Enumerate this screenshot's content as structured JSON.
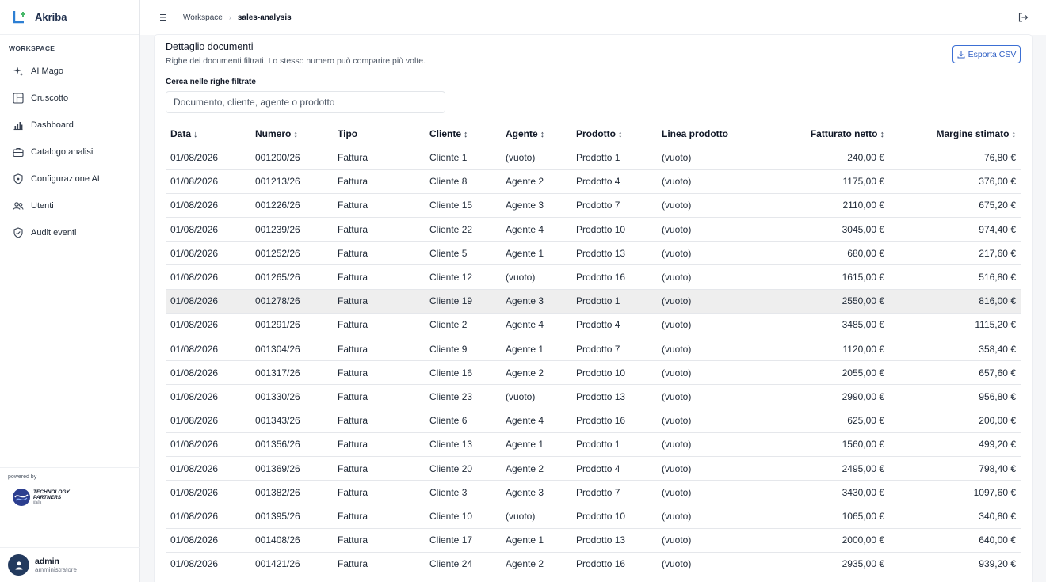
{
  "app": {
    "name": "Akriba"
  },
  "sidebar": {
    "section": "WORKSPACE",
    "items": [
      {
        "label": "AI Mago",
        "icon": "sparkle-icon"
      },
      {
        "label": "Cruscotto",
        "icon": "layout-icon"
      },
      {
        "label": "Dashboard",
        "icon": "bar-chart-icon"
      },
      {
        "label": "Catalogo analisi",
        "icon": "briefcase-icon"
      },
      {
        "label": "Configurazione AI",
        "icon": "shield-icon"
      },
      {
        "label": "Utenti",
        "icon": "users-icon"
      },
      {
        "label": "Audit eventi",
        "icon": "shield-check-icon"
      }
    ],
    "powered_by": "powered by",
    "partner_line1": "TECHNOLOGY",
    "partner_line2": "PARTNERS",
    "partner_line3": "italia"
  },
  "user": {
    "name": "admin",
    "role": "amministratore"
  },
  "breadcrumb": {
    "root": "Workspace",
    "current": "sales-analysis"
  },
  "card": {
    "title": "Dettaglio documenti",
    "subtitle": "Righe dei documenti filtrati. Lo stesso numero può comparire più volte.",
    "export_label": "Esporta CSV",
    "search_label": "Cerca nelle righe filtrate",
    "search_placeholder": "Documento, cliente, agente o prodotto"
  },
  "table": {
    "columns": [
      {
        "label": "Data",
        "sort": "↓"
      },
      {
        "label": "Numero",
        "sort": "↕"
      },
      {
        "label": "Tipo",
        "sort": ""
      },
      {
        "label": "Cliente",
        "sort": "↕"
      },
      {
        "label": "Agente",
        "sort": "↕"
      },
      {
        "label": "Prodotto",
        "sort": "↕"
      },
      {
        "label": "Linea prodotto",
        "sort": ""
      },
      {
        "label": "Fatturato netto",
        "sort": "↕"
      },
      {
        "label": "Margine stimato",
        "sort": "↕"
      }
    ],
    "highlighted_row": 6,
    "rows": [
      [
        "01/08/2026",
        "001200/26",
        "Fattura",
        "Cliente 1",
        "(vuoto)",
        "Prodotto 1",
        "(vuoto)",
        "240,00 €",
        "76,80 €"
      ],
      [
        "01/08/2026",
        "001213/26",
        "Fattura",
        "Cliente 8",
        "Agente 2",
        "Prodotto 4",
        "(vuoto)",
        "1175,00 €",
        "376,00 €"
      ],
      [
        "01/08/2026",
        "001226/26",
        "Fattura",
        "Cliente 15",
        "Agente 3",
        "Prodotto 7",
        "(vuoto)",
        "2110,00 €",
        "675,20 €"
      ],
      [
        "01/08/2026",
        "001239/26",
        "Fattura",
        "Cliente 22",
        "Agente 4",
        "Prodotto 10",
        "(vuoto)",
        "3045,00 €",
        "974,40 €"
      ],
      [
        "01/08/2026",
        "001252/26",
        "Fattura",
        "Cliente 5",
        "Agente 1",
        "Prodotto 13",
        "(vuoto)",
        "680,00 €",
        "217,60 €"
      ],
      [
        "01/08/2026",
        "001265/26",
        "Fattura",
        "Cliente 12",
        "(vuoto)",
        "Prodotto 16",
        "(vuoto)",
        "1615,00 €",
        "516,80 €"
      ],
      [
        "01/08/2026",
        "001278/26",
        "Fattura",
        "Cliente 19",
        "Agente 3",
        "Prodotto 1",
        "(vuoto)",
        "2550,00 €",
        "816,00 €"
      ],
      [
        "01/08/2026",
        "001291/26",
        "Fattura",
        "Cliente 2",
        "Agente 4",
        "Prodotto 4",
        "(vuoto)",
        "3485,00 €",
        "1115,20 €"
      ],
      [
        "01/08/2026",
        "001304/26",
        "Fattura",
        "Cliente 9",
        "Agente 1",
        "Prodotto 7",
        "(vuoto)",
        "1120,00 €",
        "358,40 €"
      ],
      [
        "01/08/2026",
        "001317/26",
        "Fattura",
        "Cliente 16",
        "Agente 2",
        "Prodotto 10",
        "(vuoto)",
        "2055,00 €",
        "657,60 €"
      ],
      [
        "01/08/2026",
        "001330/26",
        "Fattura",
        "Cliente 23",
        "(vuoto)",
        "Prodotto 13",
        "(vuoto)",
        "2990,00 €",
        "956,80 €"
      ],
      [
        "01/08/2026",
        "001343/26",
        "Fattura",
        "Cliente 6",
        "Agente 4",
        "Prodotto 16",
        "(vuoto)",
        "625,00 €",
        "200,00 €"
      ],
      [
        "01/08/2026",
        "001356/26",
        "Fattura",
        "Cliente 13",
        "Agente 1",
        "Prodotto 1",
        "(vuoto)",
        "1560,00 €",
        "499,20 €"
      ],
      [
        "01/08/2026",
        "001369/26",
        "Fattura",
        "Cliente 20",
        "Agente 2",
        "Prodotto 4",
        "(vuoto)",
        "2495,00 €",
        "798,40 €"
      ],
      [
        "01/08/2026",
        "001382/26",
        "Fattura",
        "Cliente 3",
        "Agente 3",
        "Prodotto 7",
        "(vuoto)",
        "3430,00 €",
        "1097,60 €"
      ],
      [
        "01/08/2026",
        "001395/26",
        "Fattura",
        "Cliente 10",
        "(vuoto)",
        "Prodotto 10",
        "(vuoto)",
        "1065,00 €",
        "340,80 €"
      ],
      [
        "01/08/2026",
        "001408/26",
        "Fattura",
        "Cliente 17",
        "Agente 1",
        "Prodotto 13",
        "(vuoto)",
        "2000,00 €",
        "640,00 €"
      ],
      [
        "01/08/2026",
        "001421/26",
        "Fattura",
        "Cliente 24",
        "Agente 2",
        "Prodotto 16",
        "(vuoto)",
        "2935,00 €",
        "939,20 €"
      ]
    ]
  }
}
